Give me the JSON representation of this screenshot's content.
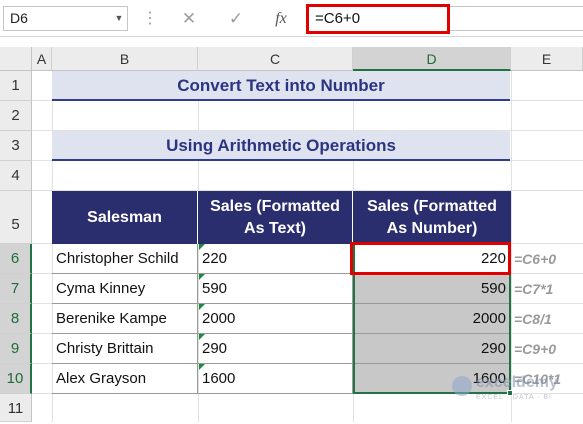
{
  "formula_bar": {
    "name_box": "D6",
    "cancel_icon": "✕",
    "enter_icon": "✓",
    "fx_label": "fx",
    "formula": "=C6+0"
  },
  "columns": [
    "A",
    "B",
    "C",
    "D",
    "E"
  ],
  "selected_column": "D",
  "rows": [
    "1",
    "2",
    "3",
    "4",
    "5",
    "6",
    "7",
    "8",
    "9",
    "10",
    "11"
  ],
  "selected_rows": [
    "6",
    "7",
    "8",
    "9",
    "10"
  ],
  "title": "Convert Text into Number",
  "subtitle": "Using Arithmetic Operations",
  "table": {
    "headers": {
      "salesman": "Salesman",
      "sales_text_line1": "Sales (Formatted",
      "sales_text_line2": "As Text)",
      "sales_number_line1": "Sales (Formatted",
      "sales_number_line2": "As Number)"
    },
    "rows": [
      {
        "salesman": "Christopher Schild",
        "text": "220",
        "number": "220",
        "formula": "=C6+0"
      },
      {
        "salesman": "Cyma Kinney",
        "text": "590",
        "number": "590",
        "formula": "=C7*1"
      },
      {
        "salesman": "Berenike Kampe",
        "text": "2000",
        "number": "2000",
        "formula": "=C8/1"
      },
      {
        "salesman": "Christy Brittain",
        "text": "290",
        "number": "290",
        "formula": "=C9+0"
      },
      {
        "salesman": "Alex Grayson",
        "text": "1600",
        "number": "1600",
        "formula": "=C10*1"
      }
    ]
  },
  "watermark": {
    "name": "exceldemy",
    "tagline": "EXCEL · DATA · BI"
  },
  "colors": {
    "header_fill": "#2b2e6e",
    "title_text": "#2b3480",
    "band_fill": "#dfe3f0",
    "highlight": "#e00000",
    "selection": "#217346"
  }
}
